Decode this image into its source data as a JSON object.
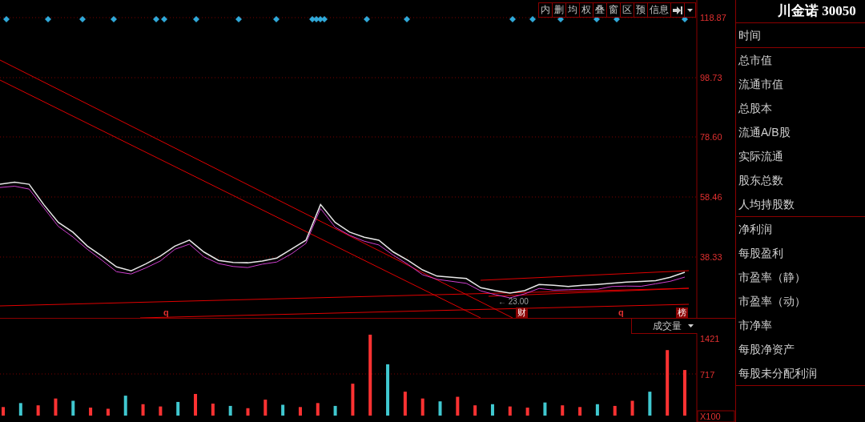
{
  "toolbar": {
    "buttons": [
      "内",
      "删",
      "均",
      "权",
      "叠",
      "窗",
      "区",
      "预",
      "信息"
    ]
  },
  "stock_title": "川金诺 30050",
  "price_chart": {
    "axis_labels": [
      "118.87",
      "98.73",
      "78.60",
      "58.46",
      "38.33"
    ],
    "labels": [
      {
        "kind": "low",
        "text": "← 23.00"
      },
      {
        "kind": "mark",
        "text": "q"
      },
      {
        "kind": "flag",
        "text": "财"
      },
      {
        "kind": "mark",
        "text": "q"
      },
      {
        "kind": "flag",
        "text": "榜"
      }
    ]
  },
  "volume_chart": {
    "selector": "成交量",
    "axis_labels": [
      "1421",
      "717"
    ],
    "unit": "X100"
  },
  "info_panel": {
    "sections": [
      [
        "时间"
      ],
      [
        "总市值",
        "流通市值",
        "总股本",
        "流通A/B股",
        "实际流通",
        "股东总数",
        "人均持股数"
      ],
      [
        "净利润",
        "每股盈利",
        "市盈率（静）",
        "市盈率（动）",
        "市净率",
        "每股净资产",
        "每股未分配利润"
      ]
    ]
  }
}
